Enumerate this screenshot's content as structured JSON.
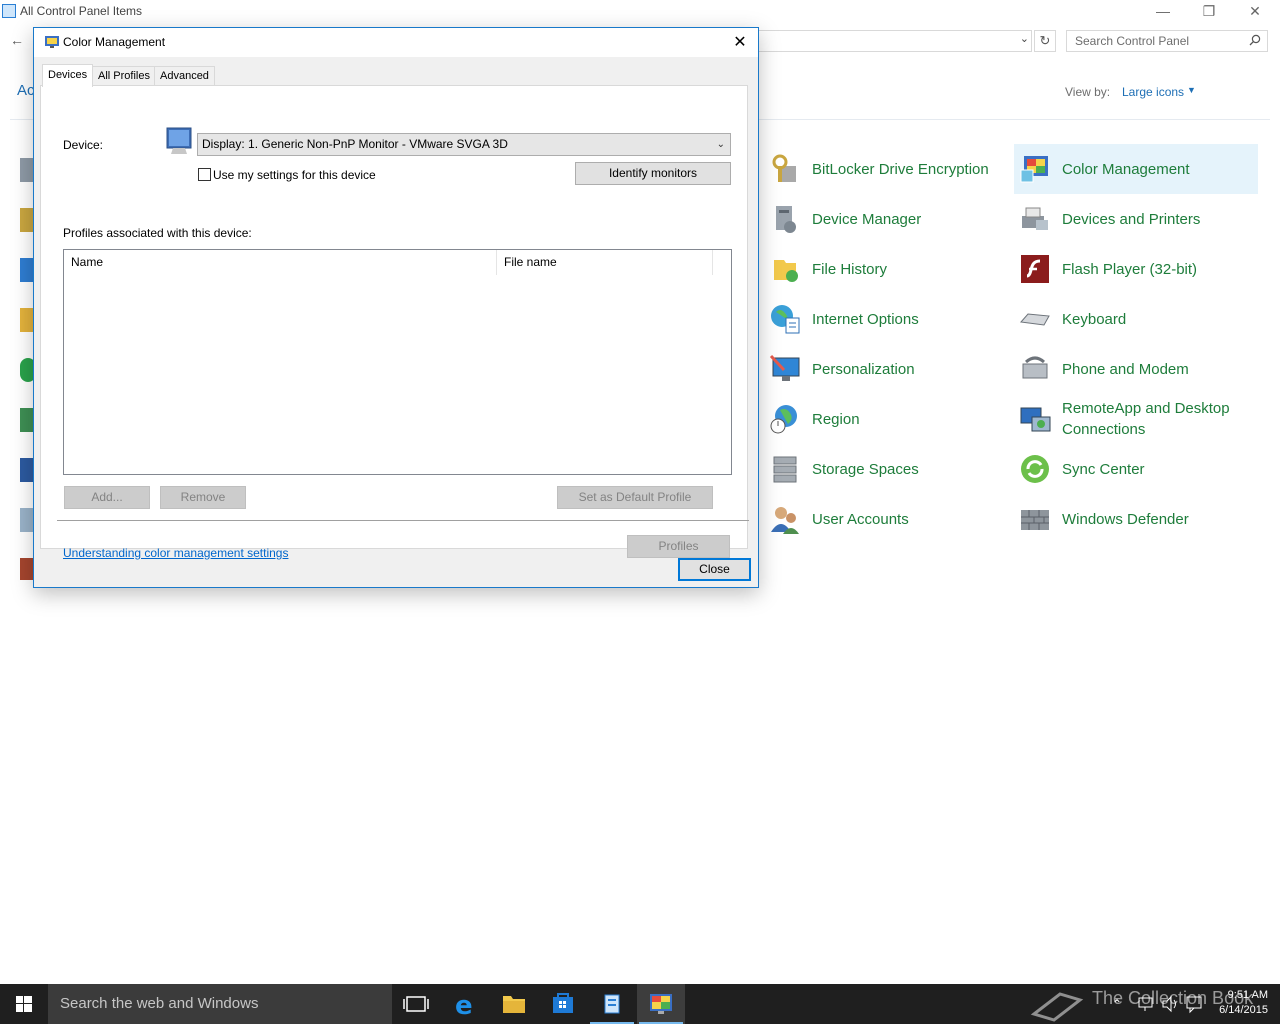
{
  "control_panel": {
    "title": "All Control Panel Items",
    "adjust_heading_fragment": "Ac",
    "search_placeholder": "Search Control Panel",
    "view_by_label": "View by:",
    "view_by_value": "Large icons",
    "items": [
      {
        "label": "BitLocker Drive Encryption",
        "icon": "bitlocker-icon"
      },
      {
        "label": "Color Management",
        "icon": "color-management-icon",
        "selected": true
      },
      {
        "label": "Device Manager",
        "icon": "device-manager-icon"
      },
      {
        "label": "Devices and Printers",
        "icon": "devices-printers-icon"
      },
      {
        "label": "File History",
        "icon": "file-history-icon"
      },
      {
        "label": "Flash Player (32-bit)",
        "icon": "flash-player-icon"
      },
      {
        "label": "Internet Options",
        "icon": "internet-options-icon"
      },
      {
        "label": "Keyboard",
        "icon": "keyboard-icon"
      },
      {
        "label": "Personalization",
        "icon": "personalization-icon"
      },
      {
        "label": "Phone and Modem",
        "icon": "phone-modem-icon"
      },
      {
        "label": "Region",
        "icon": "region-icon"
      },
      {
        "label": "RemoteApp and Desktop Connections",
        "icon": "remoteapp-icon"
      },
      {
        "label": "Storage Spaces",
        "icon": "storage-spaces-icon"
      },
      {
        "label": "Sync Center",
        "icon": "sync-center-icon"
      },
      {
        "label": "User Accounts",
        "icon": "user-accounts-icon"
      },
      {
        "label": "Windows Defender",
        "icon": "windows-defender-icon"
      }
    ]
  },
  "dialog": {
    "title": "Color Management",
    "tabs": [
      "Devices",
      "All Profiles",
      "Advanced"
    ],
    "active_tab": "Devices",
    "device_label": "Device:",
    "device_value": "Display: 1. Generic Non-PnP Monitor - VMware SVGA 3D",
    "use_my_settings_label": "Use my settings for this device",
    "use_my_settings_checked": false,
    "identify_monitors": "Identify monitors",
    "profiles_label": "Profiles associated with this device:",
    "columns": [
      "Name",
      "File name"
    ],
    "rows": [],
    "add_button": "Add...",
    "remove_button": "Remove",
    "set_default_button": "Set as Default Profile",
    "profiles_button": "Profiles",
    "help_link": "Understanding color management settings",
    "close_button": "Close"
  },
  "taskbar": {
    "search_placeholder": "Search the web and Windows",
    "time": "9:51 AM",
    "date": "6/14/2015",
    "watermark": "The Collection Book"
  },
  "colors": {
    "accent": "#0078d7",
    "item_label": "#1e7d3b",
    "link": "#0066cc",
    "selection": "#e5f3fb"
  }
}
